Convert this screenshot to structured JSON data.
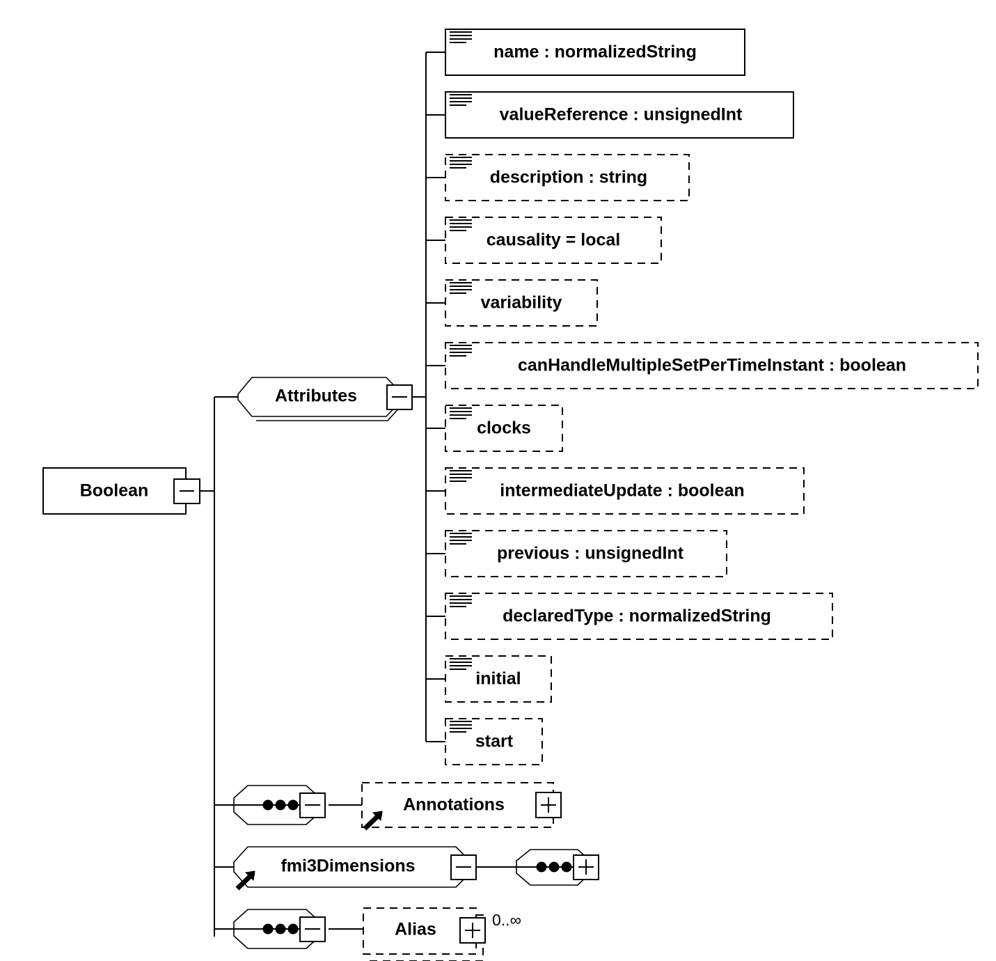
{
  "diagram": {
    "type": "xml-schema-tree",
    "root": {
      "label": "Boolean",
      "shape": "element-box",
      "expander": "minus"
    },
    "groups": [
      {
        "label": "Attributes",
        "shape": "attribute-group-octagon",
        "expander": "minus",
        "attributes": [
          {
            "label": "name : normalizedString",
            "required": true,
            "icon": "attribute-icon"
          },
          {
            "label": "valueReference : unsignedInt",
            "required": true,
            "icon": "attribute-icon"
          },
          {
            "label": "description : string",
            "required": false,
            "icon": "attribute-icon"
          },
          {
            "label": "causality = local",
            "required": false,
            "icon": "attribute-icon"
          },
          {
            "label": "variability",
            "required": false,
            "icon": "attribute-icon"
          },
          {
            "label": "canHandleMultipleSetPerTimeInstant : boolean",
            "required": false,
            "icon": "attribute-icon"
          },
          {
            "label": "clocks",
            "required": false,
            "icon": "attribute-icon"
          },
          {
            "label": "intermediateUpdate : boolean",
            "required": false,
            "icon": "attribute-icon"
          },
          {
            "label": "previous : unsignedInt",
            "required": false,
            "icon": "attribute-icon"
          },
          {
            "label": "declaredType : normalizedString",
            "required": false,
            "icon": "attribute-icon"
          },
          {
            "label": "initial",
            "required": false,
            "icon": "attribute-icon"
          },
          {
            "label": "start",
            "required": false,
            "icon": "attribute-icon"
          }
        ]
      }
    ],
    "children": [
      {
        "sequence": {
          "shape": "sequence-octagon",
          "expander": "minus",
          "icon": "sequence-dots-icon"
        },
        "element": {
          "label": "Annotations",
          "optional": true,
          "expander": "plus",
          "icon": "reference-arrow-icon",
          "stacked": false,
          "cardinality": ""
        }
      },
      {
        "element": {
          "label": "fmi3Dimensions",
          "shape": "group-octagon",
          "expander": "minus",
          "icon": "reference-arrow-icon"
        },
        "sequence": {
          "shape": "sequence-octagon",
          "expander": "plus",
          "icon": "sequence-dots-icon"
        }
      },
      {
        "sequence": {
          "shape": "sequence-octagon",
          "expander": "minus",
          "icon": "sequence-dots-icon"
        },
        "element": {
          "label": "Alias",
          "optional": true,
          "expander": "plus",
          "icon": "",
          "stacked": true,
          "cardinality": "0..∞"
        }
      }
    ]
  },
  "colors": {
    "line": "#000000",
    "fill": "#ffffff",
    "text": "#000000"
  }
}
